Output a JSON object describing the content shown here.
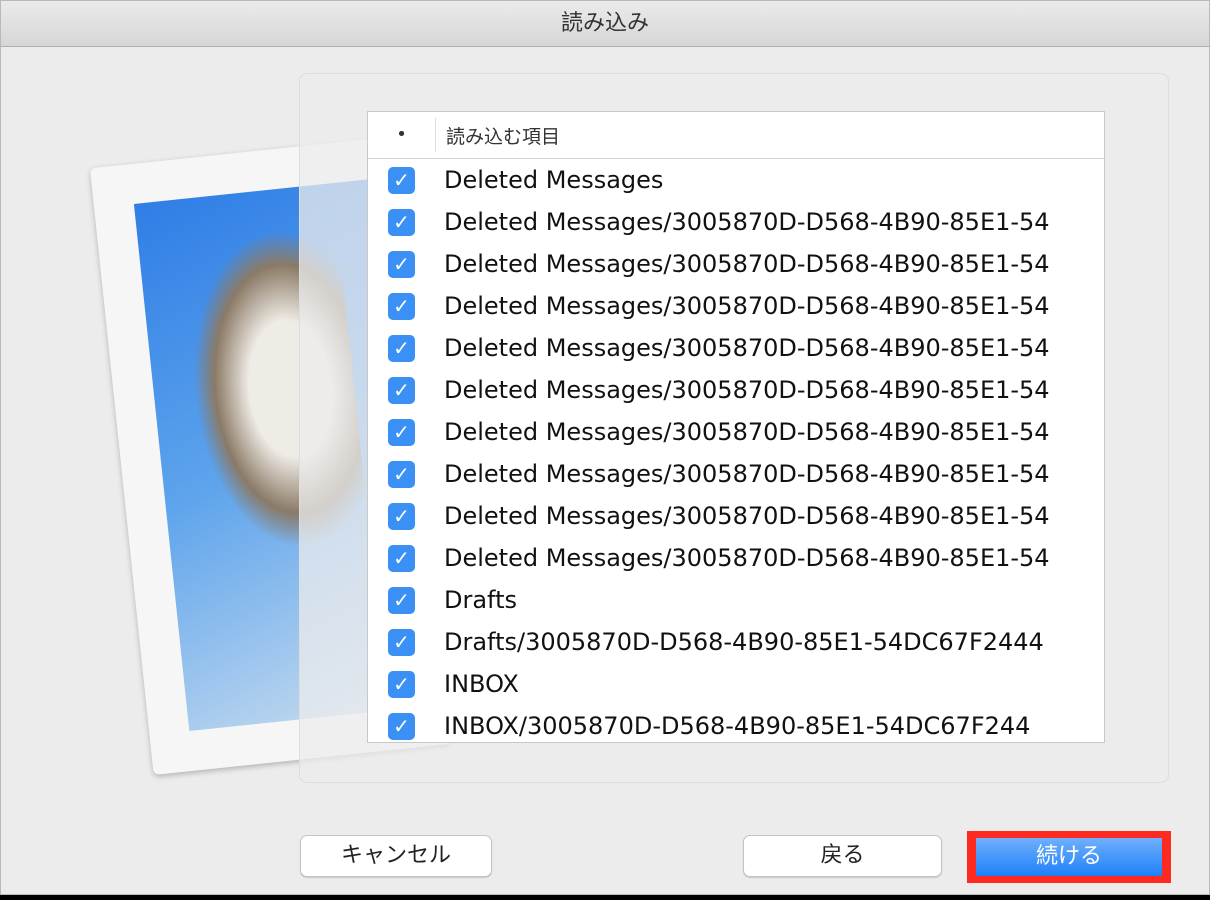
{
  "window": {
    "title": "読み込み"
  },
  "list": {
    "header_marker": "•",
    "header_label": "読み込む項目",
    "items": [
      {
        "label": "Deleted Messages",
        "checked": true
      },
      {
        "label": "Deleted Messages/3005870D-D568-4B90-85E1-54",
        "checked": true
      },
      {
        "label": "Deleted Messages/3005870D-D568-4B90-85E1-54",
        "checked": true
      },
      {
        "label": "Deleted Messages/3005870D-D568-4B90-85E1-54",
        "checked": true
      },
      {
        "label": "Deleted Messages/3005870D-D568-4B90-85E1-54",
        "checked": true
      },
      {
        "label": "Deleted Messages/3005870D-D568-4B90-85E1-54",
        "checked": true
      },
      {
        "label": "Deleted Messages/3005870D-D568-4B90-85E1-54",
        "checked": true
      },
      {
        "label": "Deleted Messages/3005870D-D568-4B90-85E1-54",
        "checked": true
      },
      {
        "label": "Deleted Messages/3005870D-D568-4B90-85E1-54",
        "checked": true
      },
      {
        "label": "Deleted Messages/3005870D-D568-4B90-85E1-54",
        "checked": true
      },
      {
        "label": "Drafts",
        "checked": true
      },
      {
        "label": "Drafts/3005870D-D568-4B90-85E1-54DC67F2444",
        "checked": true
      },
      {
        "label": "INBOX",
        "checked": true
      },
      {
        "label": "INBOX/3005870D-D568-4B90-85E1-54DC67F244",
        "checked": true
      }
    ]
  },
  "buttons": {
    "cancel": "キャンセル",
    "back": "戻る",
    "continue": "続ける"
  }
}
